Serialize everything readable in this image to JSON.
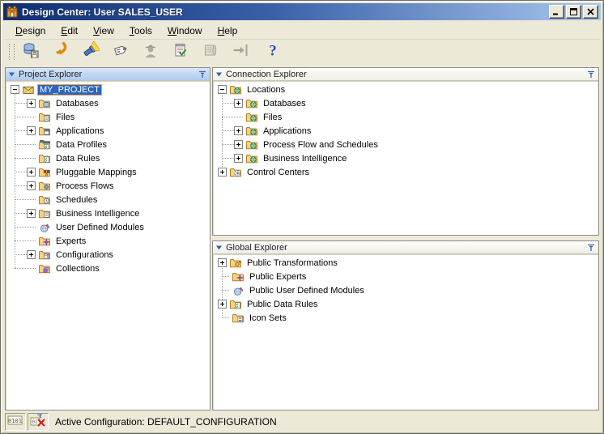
{
  "window": {
    "title": "Design Center: User SALES_USER",
    "controls": [
      {
        "name": "minimize",
        "icon": "minimize-icon"
      },
      {
        "name": "maximize",
        "icon": "maximize-icon"
      },
      {
        "name": "close",
        "icon": "close-icon"
      }
    ]
  },
  "menu": {
    "items": [
      {
        "label": "Design"
      },
      {
        "label": "Edit"
      },
      {
        "label": "View"
      },
      {
        "label": "Tools"
      },
      {
        "label": "Window"
      },
      {
        "label": "Help"
      }
    ]
  },
  "toolbar": {
    "buttons": [
      {
        "name": "save-all",
        "icon": "database-save-icon",
        "enabled": true
      },
      {
        "name": "refresh",
        "icon": "refresh-arrow-icon",
        "enabled": true
      },
      {
        "name": "search",
        "icon": "flashlight-search-icon",
        "enabled": true
      },
      {
        "name": "tag",
        "icon": "tag-icon",
        "enabled": true
      },
      {
        "name": "debug",
        "icon": "spy-icon",
        "enabled": false
      },
      {
        "name": "validate",
        "icon": "validate-notepad-icon",
        "enabled": true
      },
      {
        "name": "generate",
        "icon": "generate-scroll-icon",
        "enabled": false
      },
      {
        "name": "deploy",
        "icon": "deploy-arrow-icon",
        "enabled": false
      },
      {
        "name": "help",
        "icon": "help-question-icon",
        "enabled": true
      }
    ]
  },
  "panels": {
    "project_explorer": {
      "title": "Project Explorer",
      "active": true,
      "items": [
        {
          "label": "MY_PROJECT",
          "indent": 0,
          "expander": "minus",
          "icon": "project-envelope-icon",
          "selected": true
        },
        {
          "label": "Databases",
          "indent": 1,
          "expander": "plus",
          "icon": "databases-folder-icon"
        },
        {
          "label": "Files",
          "indent": 1,
          "expander": "none",
          "icon": "files-folder-icon"
        },
        {
          "label": "Applications",
          "indent": 1,
          "expander": "plus",
          "icon": "applications-folder-icon"
        },
        {
          "label": "Data Profiles",
          "indent": 1,
          "expander": "none",
          "icon": "data-profiles-folder-icon"
        },
        {
          "label": "Data Rules",
          "indent": 1,
          "expander": "none",
          "icon": "data-rules-folder-icon"
        },
        {
          "label": "Pluggable Mappings",
          "indent": 1,
          "expander": "plus",
          "icon": "pluggable-mappings-folder-icon"
        },
        {
          "label": "Process Flows",
          "indent": 1,
          "expander": "plus",
          "icon": "process-flows-folder-icon"
        },
        {
          "label": "Schedules",
          "indent": 1,
          "expander": "none",
          "icon": "schedules-folder-icon"
        },
        {
          "label": "Business Intelligence",
          "indent": 1,
          "expander": "plus",
          "icon": "business-intelligence-folder-icon"
        },
        {
          "label": "User Defined Modules",
          "indent": 1,
          "expander": "none",
          "icon": "user-defined-modules-icon"
        },
        {
          "label": "Experts",
          "indent": 1,
          "expander": "none",
          "icon": "experts-folder-icon"
        },
        {
          "label": "Configurations",
          "indent": 1,
          "expander": "plus",
          "icon": "configurations-folder-icon"
        },
        {
          "label": "Collections",
          "indent": 1,
          "expander": "none",
          "icon": "collections-folder-icon"
        }
      ]
    },
    "connection_explorer": {
      "title": "Connection Explorer",
      "active": false,
      "items": [
        {
          "label": "Locations",
          "indent": 0,
          "expander": "minus",
          "icon": "globe-folder-icon"
        },
        {
          "label": "Databases",
          "indent": 1,
          "expander": "plus",
          "icon": "globe-folder-icon"
        },
        {
          "label": "Files",
          "indent": 1,
          "expander": "none",
          "icon": "globe-folder-icon"
        },
        {
          "label": "Applications",
          "indent": 1,
          "expander": "plus",
          "icon": "globe-folder-icon"
        },
        {
          "label": "Process Flow and Schedules",
          "indent": 1,
          "expander": "plus",
          "icon": "globe-folder-icon"
        },
        {
          "label": "Business Intelligence",
          "indent": 1,
          "expander": "plus",
          "icon": "globe-folder-icon"
        },
        {
          "label": "Control Centers",
          "indent": 0,
          "expander": "plus",
          "icon": "control-centers-folder-icon"
        }
      ]
    },
    "global_explorer": {
      "title": "Global Explorer",
      "active": false,
      "items": [
        {
          "label": "Public Transformations",
          "indent": 0,
          "expander": "plus",
          "icon": "public-transformations-folder-icon"
        },
        {
          "label": "Public Experts",
          "indent": 0,
          "expander": "none",
          "icon": "experts-folder-icon"
        },
        {
          "label": "Public User Defined Modules",
          "indent": 0,
          "expander": "none",
          "icon": "user-defined-modules-icon"
        },
        {
          "label": "Public Data Rules",
          "indent": 0,
          "expander": "plus",
          "icon": "data-rules-folder-icon"
        },
        {
          "label": "Icon Sets",
          "indent": 0,
          "expander": "none",
          "icon": "icon-sets-folder-icon"
        }
      ]
    }
  },
  "statusbar": {
    "icons": [
      "binary-log-icon",
      "binary-error-icon"
    ],
    "text": "Active Configuration: DEFAULT_CONFIGURATION"
  },
  "colors": {
    "titlebar_start": "#0F2D72",
    "titlebar_end": "#A8C7EE",
    "window_bg": "#ECE9D8",
    "selection_bg": "#2A65C0",
    "selection_border": "#E8A33D",
    "active_header_top": "#D9E6F8",
    "active_header_bottom": "#AFCBEF"
  }
}
